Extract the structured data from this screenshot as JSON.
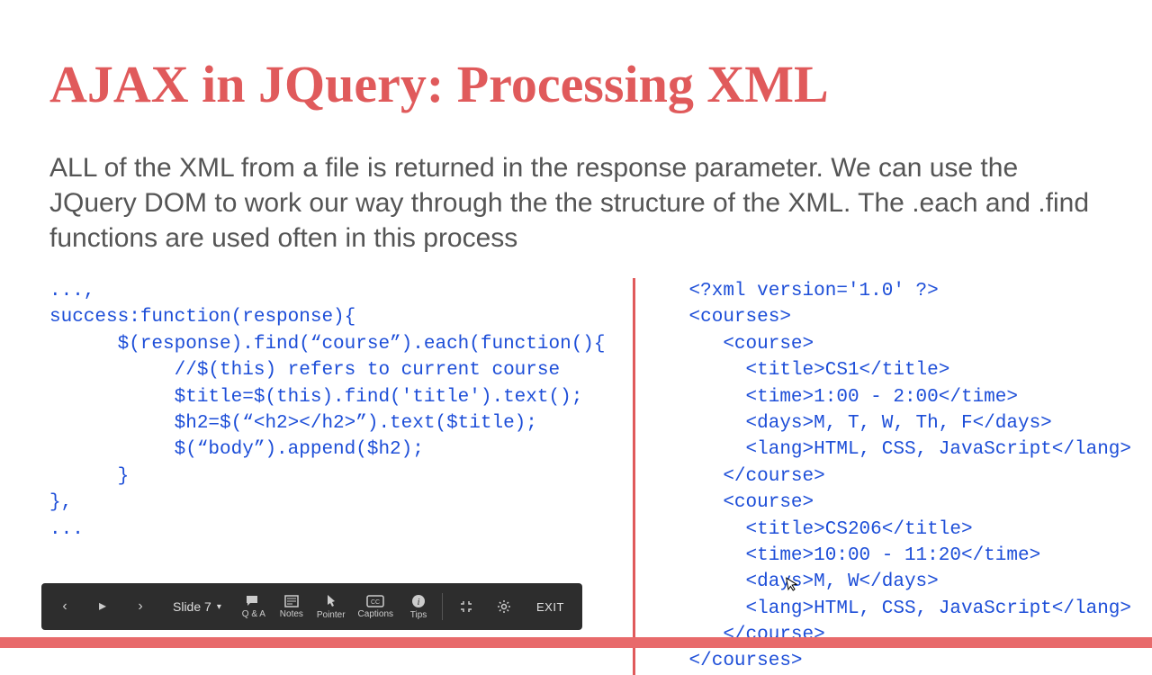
{
  "slide": {
    "title": "AJAX in JQuery: Processing XML",
    "body": "ALL of the XML from a file is returned in the response parameter.  We can use the JQuery DOM to work our way through the the structure of the XML. The .each and .find functions are used often in this process",
    "code_left": "...,\nsuccess:function(response){\n      $(response).find(“course”).each(function(){\n           //$(this) refers to current course\n           $title=$(this).find('title').text();\n           $h2=$(“<h2></h2>”).text($title);\n           $(“body”).append($h2);\n      }\n},\n...",
    "code_right": "<?xml version='1.0' ?>\n<courses>\n   <course>\n     <title>CS1</title>\n     <time>1:00 - 2:00</time>\n     <days>M, T, W, Th, F</days>\n     <lang>HTML, CSS, JavaScript</lang>\n   </course>\n   <course>\n     <title>CS206</title>\n     <time>10:00 - 11:20</time>\n     <days>M, W</days>\n     <lang>HTML, CSS, JavaScript</lang>\n   </course>\n</courses>"
  },
  "toolbar": {
    "slide_label": "Slide 7",
    "qa": "Q & A",
    "notes": "Notes",
    "pointer": "Pointer",
    "captions": "Captions",
    "tips": "Tips",
    "exit": "EXIT"
  }
}
